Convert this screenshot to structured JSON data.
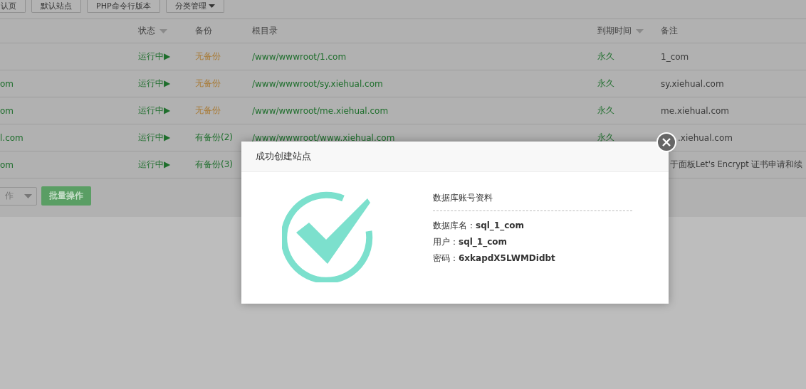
{
  "toolbar": {
    "buttons": [
      {
        "label": "认页",
        "dropdown": false
      },
      {
        "label": "默认站点",
        "dropdown": false
      },
      {
        "label": "PHP命令行版本",
        "dropdown": false
      },
      {
        "label": "分类管理",
        "dropdown": true
      }
    ]
  },
  "table": {
    "columns": [
      {
        "label": "状态",
        "sortable": true
      },
      {
        "label": "备份",
        "sortable": false
      },
      {
        "label": "根目录",
        "sortable": false
      },
      {
        "label": "到期时间",
        "sortable": true
      },
      {
        "label": "备注",
        "sortable": false
      }
    ],
    "rows": [
      {
        "status": "运行中▶",
        "backup": "无备份",
        "has_backup": false,
        "path": "/www/wwwroot/1.com",
        "expiry": "永久",
        "note": "1_com"
      },
      {
        "site": "om",
        "status": "运行中▶",
        "backup": "无备份",
        "has_backup": false,
        "path": "/www/wwwroot/sy.xiehual.com",
        "expiry": "永久",
        "note": "sy.xiehual.com"
      },
      {
        "site": "om",
        "status": "运行中▶",
        "backup": "无备份",
        "has_backup": false,
        "path": "/www/wwwroot/me.xiehual.com",
        "expiry": "永久",
        "note": "me.xiehual.com"
      },
      {
        "site": "l.com",
        "status": "运行中▶",
        "backup": "有备份(2)",
        "has_backup": true,
        "path": "/www/wwwroot/www.xiehual.com",
        "expiry": "永久",
        "note": ".xiehual.com"
      },
      {
        "site": "om",
        "status": "运行中▶",
        "backup": "有备份(3)",
        "has_backup": true,
        "note": "于面板Let's Encrypt 证书申请和续"
      }
    ]
  },
  "batch": {
    "select": "作",
    "button": "批量操作"
  },
  "dialog": {
    "title": "成功创建站点",
    "heading": "数据库账号资料",
    "fields": [
      {
        "label": "数据库名：",
        "value": "sql_1_com"
      },
      {
        "label": "用户：",
        "value": "sql_1_com"
      },
      {
        "label": "密码：",
        "value": "6xkapdX5LWMDidbt"
      }
    ]
  }
}
